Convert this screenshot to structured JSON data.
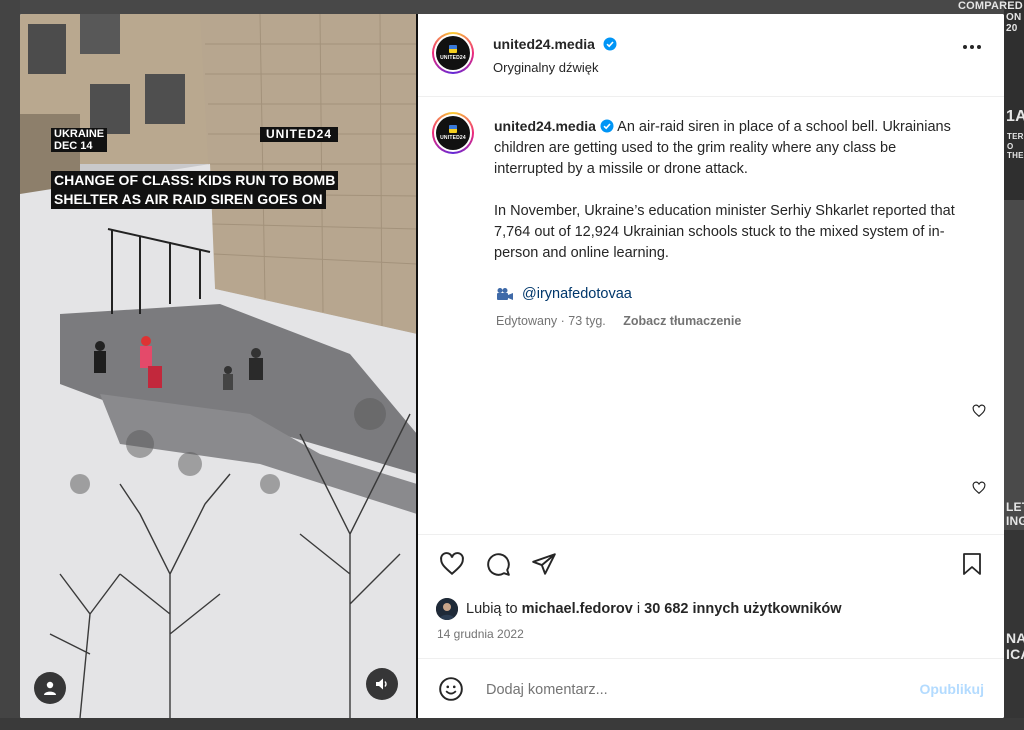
{
  "video": {
    "tag_country": "UKRAINE",
    "tag_date": "DEC 14",
    "brand_watermark": "UNITED24",
    "headline_line1": "CHANGE OF CLASS: KIDS RUN TO BOMB",
    "headline_line2": "SHELTER AS AIR RAID SIREN GOES ON"
  },
  "header": {
    "username": "united24.media",
    "audio": "Oryginalny dźwięk",
    "avatar_wordmark": "UNITED24"
  },
  "caption": {
    "username": "united24.media",
    "paragraph1": "An air-raid siren in place of a school bell. Ukrainians children are getting used to the grim reality where any class be interrupted by a missile or drone attack.",
    "paragraph2": "In November, Ukraine’s education minister Serhiy Shkarlet reported that 7,764 out of 12,924 Ukrainian schools stuck to the mixed system of in-person and online learning.",
    "mention": "@irynafedotovaa",
    "edited": "Edytowany · 73 tyg.",
    "translate": "Zobacz tłumaczenie"
  },
  "likes": {
    "prefix": "Lubią to",
    "user": "michael.fedorov",
    "joiner": "i",
    "others": "30 682 innych użytkowników"
  },
  "date": "14 grudnia 2022",
  "comment": {
    "placeholder": "Dodaj komentarz...",
    "publish": "Opublikuj"
  },
  "background": {
    "top_right": "COMPARED",
    "top_right_2": "ON 20",
    "mid_right": "1A",
    "mid_right_2": "TER",
    "mid_right_3": "O THE",
    "low_right": "LET",
    "low_right_2": "ING",
    "bottom_right": "NA",
    "bottom_right_2": "ICA"
  },
  "colors": {
    "accent_link": "#00376b",
    "verified": "#0095f6",
    "publish_disabled": "#b3dbff"
  },
  "icons": [
    "more-icon",
    "verified-icon",
    "heart-icon",
    "comment-icon",
    "share-icon",
    "save-icon",
    "emoji-icon",
    "profile-icon",
    "sound-icon",
    "video-camera-icon"
  ]
}
